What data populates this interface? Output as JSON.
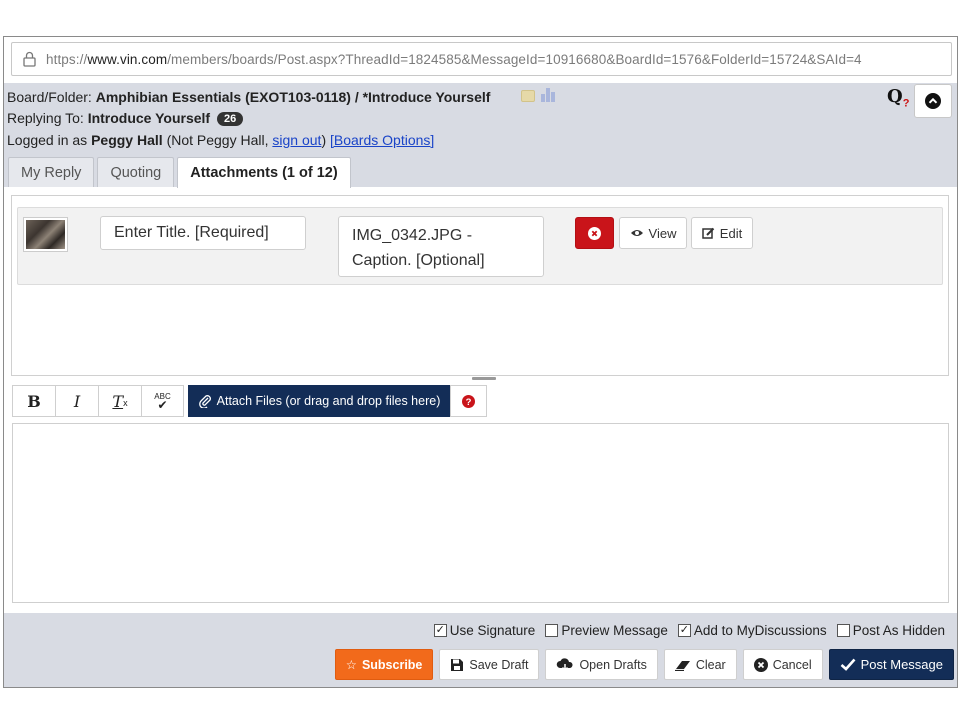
{
  "browser": {
    "url_prefix": "https://",
    "url_domain": "www.vin.com",
    "url_path": "/members/boards/Post.aspx?ThreadId=1824585&MessageId=10916680&BoardId=1576&FolderId=15724&SAId=4"
  },
  "header": {
    "board_folder_label": "Board/Folder:",
    "board_folder_value": "Amphibian Essentials (EXOT103-0118) / *Introduce Yourself",
    "replying_label": "Replying To:",
    "replying_value": "Introduce Yourself",
    "reply_count": "26",
    "logged_in_label": "Logged in as",
    "user_name": "Peggy Hall",
    "not_user_prefix": "(Not Peggy Hall,",
    "sign_out": "sign out",
    "not_user_suffix": ")",
    "boards_options": "[Boards Options]",
    "help_glyph": "Q",
    "help_sub": "?"
  },
  "tabs": [
    {
      "label": "My Reply",
      "active": false
    },
    {
      "label": "Quoting",
      "active": false
    },
    {
      "label": "Attachments (1 of 12)",
      "active": true
    }
  ],
  "attachment": {
    "title_placeholder": "Enter Title. [Required]",
    "caption_text": "IMG_0342.JPG - Caption. [Optional]",
    "view_label": "View",
    "edit_label": "Edit"
  },
  "toolbar": {
    "bold": "B",
    "italic": "I",
    "clear_format": "T",
    "spellcheck": "ABC",
    "attach_label": "Attach Files (or drag and drop files here)"
  },
  "footer": {
    "options": [
      {
        "label": "Use Signature",
        "checked": true
      },
      {
        "label": "Preview Message",
        "checked": false
      },
      {
        "label": "Add to MyDiscussions",
        "checked": true
      },
      {
        "label": "Post As Hidden",
        "checked": false
      }
    ],
    "subscribe": "Subscribe",
    "save_draft": "Save Draft",
    "open_drafts": "Open Drafts",
    "clear": "Clear",
    "cancel": "Cancel",
    "post_message": "Post Message"
  },
  "colors": {
    "header_bg": "#d8dbe3",
    "navy": "#132d57",
    "orange": "#f26a1b",
    "red": "#c9141a",
    "link": "#1a44c8"
  }
}
